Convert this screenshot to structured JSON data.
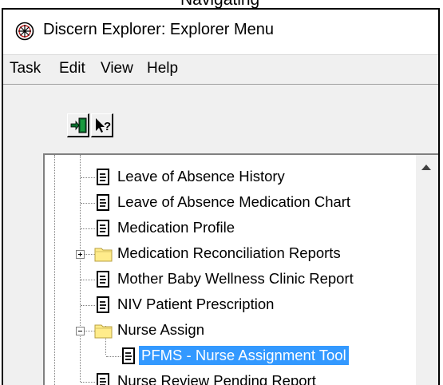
{
  "window": {
    "title": "Discern Explorer: Explorer Menu",
    "partial_top_text": "Navigating"
  },
  "menu": [
    "Task",
    "Edit",
    "View",
    "Help"
  ],
  "toolbar": {
    "buttons": [
      {
        "icon": "exit-door-icon"
      },
      {
        "icon": "context-help-icon"
      }
    ]
  },
  "tree": {
    "items": [
      {
        "label": "Leave of Absence History",
        "type": "report"
      },
      {
        "label": "Leave of Absence Medication Chart",
        "type": "report"
      },
      {
        "label": "Medication Profile",
        "type": "report"
      },
      {
        "label": "Medication Reconciliation Reports",
        "type": "folder",
        "state": "collapsed"
      },
      {
        "label": "Mother Baby Wellness Clinic Report",
        "type": "report"
      },
      {
        "label": "NIV Patient Prescription",
        "type": "report"
      },
      {
        "label": "Nurse Assign",
        "type": "folder",
        "state": "expanded"
      },
      {
        "label": "PFMS - Nurse Assignment Tool",
        "type": "report",
        "selected": true
      },
      {
        "label": "Nurse Review Pending Report",
        "type": "report"
      }
    ]
  },
  "colors": {
    "selection": "#3399ff",
    "folder": "#ffec8b"
  }
}
